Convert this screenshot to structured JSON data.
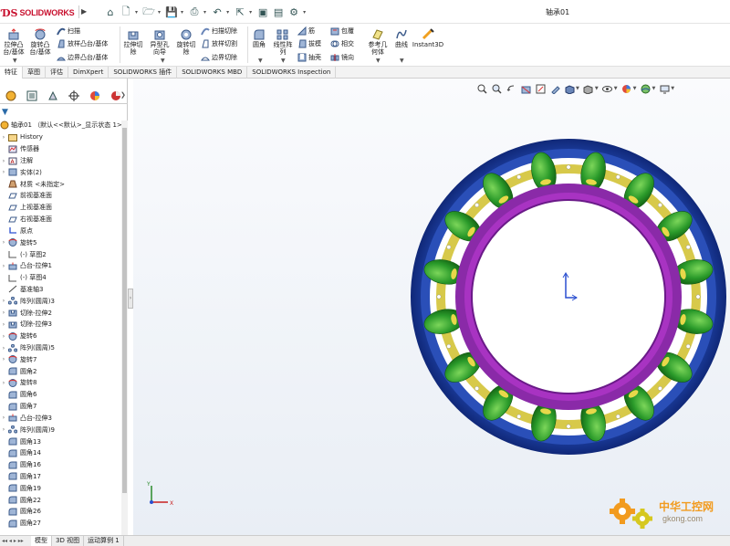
{
  "titlebar": {
    "brand": "SOLIDWORKS",
    "doc_title": "轴承01",
    "quick_access": [
      {
        "icon": "home-icon",
        "dropdown": false
      },
      {
        "icon": "new-document-icon",
        "dropdown": true
      },
      {
        "icon": "open-folder-icon",
        "dropdown": true
      },
      {
        "icon": "save-icon",
        "dropdown": true
      },
      {
        "icon": "print-icon",
        "dropdown": true
      },
      {
        "icon": "undo-icon",
        "dropdown": true
      },
      {
        "icon": "select-arrow-icon",
        "dropdown": true
      },
      {
        "icon": "rebuild-icon",
        "dropdown": false
      },
      {
        "icon": "file-properties-icon",
        "dropdown": false
      },
      {
        "icon": "options-gear-icon",
        "dropdown": true
      }
    ]
  },
  "ribbon": {
    "extrude_boss": "拉伸凸\n台/基体",
    "revolve_boss": "旋转凸\n台/基体",
    "sweep": "扫描",
    "loft_boss": "放样凸台/基体",
    "boundary_boss": "边界凸台/基体",
    "extrude_cut": "拉伸切\n除",
    "hole_wizard": "异型孔\n向导",
    "revolve_cut": "旋转切\n除",
    "swept_cut": "扫描切除",
    "lofted_cut": "放样切割",
    "boundary_cut": "边界切除",
    "fillet": "圆角",
    "linear_pattern": "线性阵\n列",
    "rib": "筋",
    "draft": "拔模",
    "shell": "抽壳",
    "wrap": "包覆",
    "intersect": "相交",
    "mirror": "镜向",
    "ref_geometry": "参考几\n何体",
    "curves": "曲线",
    "instant3d": "Instant3D"
  },
  "command_tabs": [
    {
      "label": "特征",
      "active": true
    },
    {
      "label": "草图",
      "active": false
    },
    {
      "label": "评估",
      "active": false
    },
    {
      "label": "DimXpert",
      "active": false
    },
    {
      "label": "SOLIDWORKS 插件",
      "active": false
    },
    {
      "label": "SOLIDWORKS MBD",
      "active": false
    },
    {
      "label": "SOLIDWORKS Inspection",
      "active": false
    }
  ],
  "feature_tree": {
    "root": "轴承01 （默认<<默认>_显示状态 1>）",
    "items": [
      {
        "label": "History",
        "icon": "history-folder-icon",
        "expand": true
      },
      {
        "label": "传感器",
        "icon": "sensor-icon",
        "expand": false
      },
      {
        "label": "注解",
        "icon": "annotations-icon",
        "expand": true
      },
      {
        "label": "实体(2)",
        "icon": "solid-bodies-icon",
        "expand": true
      },
      {
        "label": "材质 <未指定>",
        "icon": "material-icon",
        "expand": false
      },
      {
        "label": "前视基准面",
        "icon": "plane-icon",
        "expand": false
      },
      {
        "label": "上视基准面",
        "icon": "plane-icon",
        "expand": false
      },
      {
        "label": "右视基准面",
        "icon": "plane-icon",
        "expand": false
      },
      {
        "label": "原点",
        "icon": "origin-icon",
        "expand": false
      },
      {
        "label": "旋转5",
        "icon": "revolve-feature-icon",
        "expand": true
      },
      {
        "label": "(-) 草图2",
        "icon": "sketch-icon",
        "expand": false
      },
      {
        "label": "凸台-拉伸1",
        "icon": "extrude-feature-icon",
        "expand": true
      },
      {
        "label": "(-) 草图4",
        "icon": "sketch-icon",
        "expand": false
      },
      {
        "label": "基准轴3",
        "icon": "axis-icon",
        "expand": false
      },
      {
        "label": "阵列(圆周)3",
        "icon": "circular-pattern-icon",
        "expand": true
      },
      {
        "label": "切除-拉伸2",
        "icon": "cut-extrude-icon",
        "expand": true
      },
      {
        "label": "切除-拉伸3",
        "icon": "cut-extrude-icon",
        "expand": true
      },
      {
        "label": "旋转6",
        "icon": "revolve-feature-icon",
        "expand": true
      },
      {
        "label": "阵列(圆周)5",
        "icon": "circular-pattern-icon",
        "expand": true
      },
      {
        "label": "旋转7",
        "icon": "revolve-feature-icon",
        "expand": true
      },
      {
        "label": "圆角2",
        "icon": "fillet-feature-icon",
        "expand": false
      },
      {
        "label": "旋转8",
        "icon": "revolve-feature-icon",
        "expand": true
      },
      {
        "label": "圆角6",
        "icon": "fillet-feature-icon",
        "expand": false
      },
      {
        "label": "圆角7",
        "icon": "fillet-feature-icon",
        "expand": false
      },
      {
        "label": "凸台-拉伸3",
        "icon": "extrude-feature-icon",
        "expand": true
      },
      {
        "label": "阵列(圆周)9",
        "icon": "circular-pattern-icon",
        "expand": true
      },
      {
        "label": "圆角13",
        "icon": "fillet-feature-icon",
        "expand": false
      },
      {
        "label": "圆角14",
        "icon": "fillet-feature-icon",
        "expand": false
      },
      {
        "label": "圆角16",
        "icon": "fillet-feature-icon",
        "expand": false
      },
      {
        "label": "圆角17",
        "icon": "fillet-feature-icon",
        "expand": false
      },
      {
        "label": "圆角19",
        "icon": "fillet-feature-icon",
        "expand": false
      },
      {
        "label": "圆角22",
        "icon": "fillet-feature-icon",
        "expand": false
      },
      {
        "label": "圆角26",
        "icon": "fillet-feature-icon",
        "expand": false
      },
      {
        "label": "圆角27",
        "icon": "fillet-feature-icon",
        "expand": false
      }
    ]
  },
  "viewport": {
    "triad": {
      "x_label": "X",
      "y_label": "Y",
      "z_label": "Z"
    },
    "watermark_name": "中华工控网",
    "watermark_url": "gkong.com",
    "colors": {
      "outer_ring": "#1d3d9a",
      "inner_ring": "#8a1fa0",
      "rollers": "#2f9e2f",
      "cage": "#d7c94a"
    }
  },
  "bottom_tabs": [
    {
      "label": "模型",
      "active": true
    },
    {
      "label": "3D 视图",
      "active": false
    },
    {
      "label": "运动算例 1",
      "active": false
    }
  ]
}
